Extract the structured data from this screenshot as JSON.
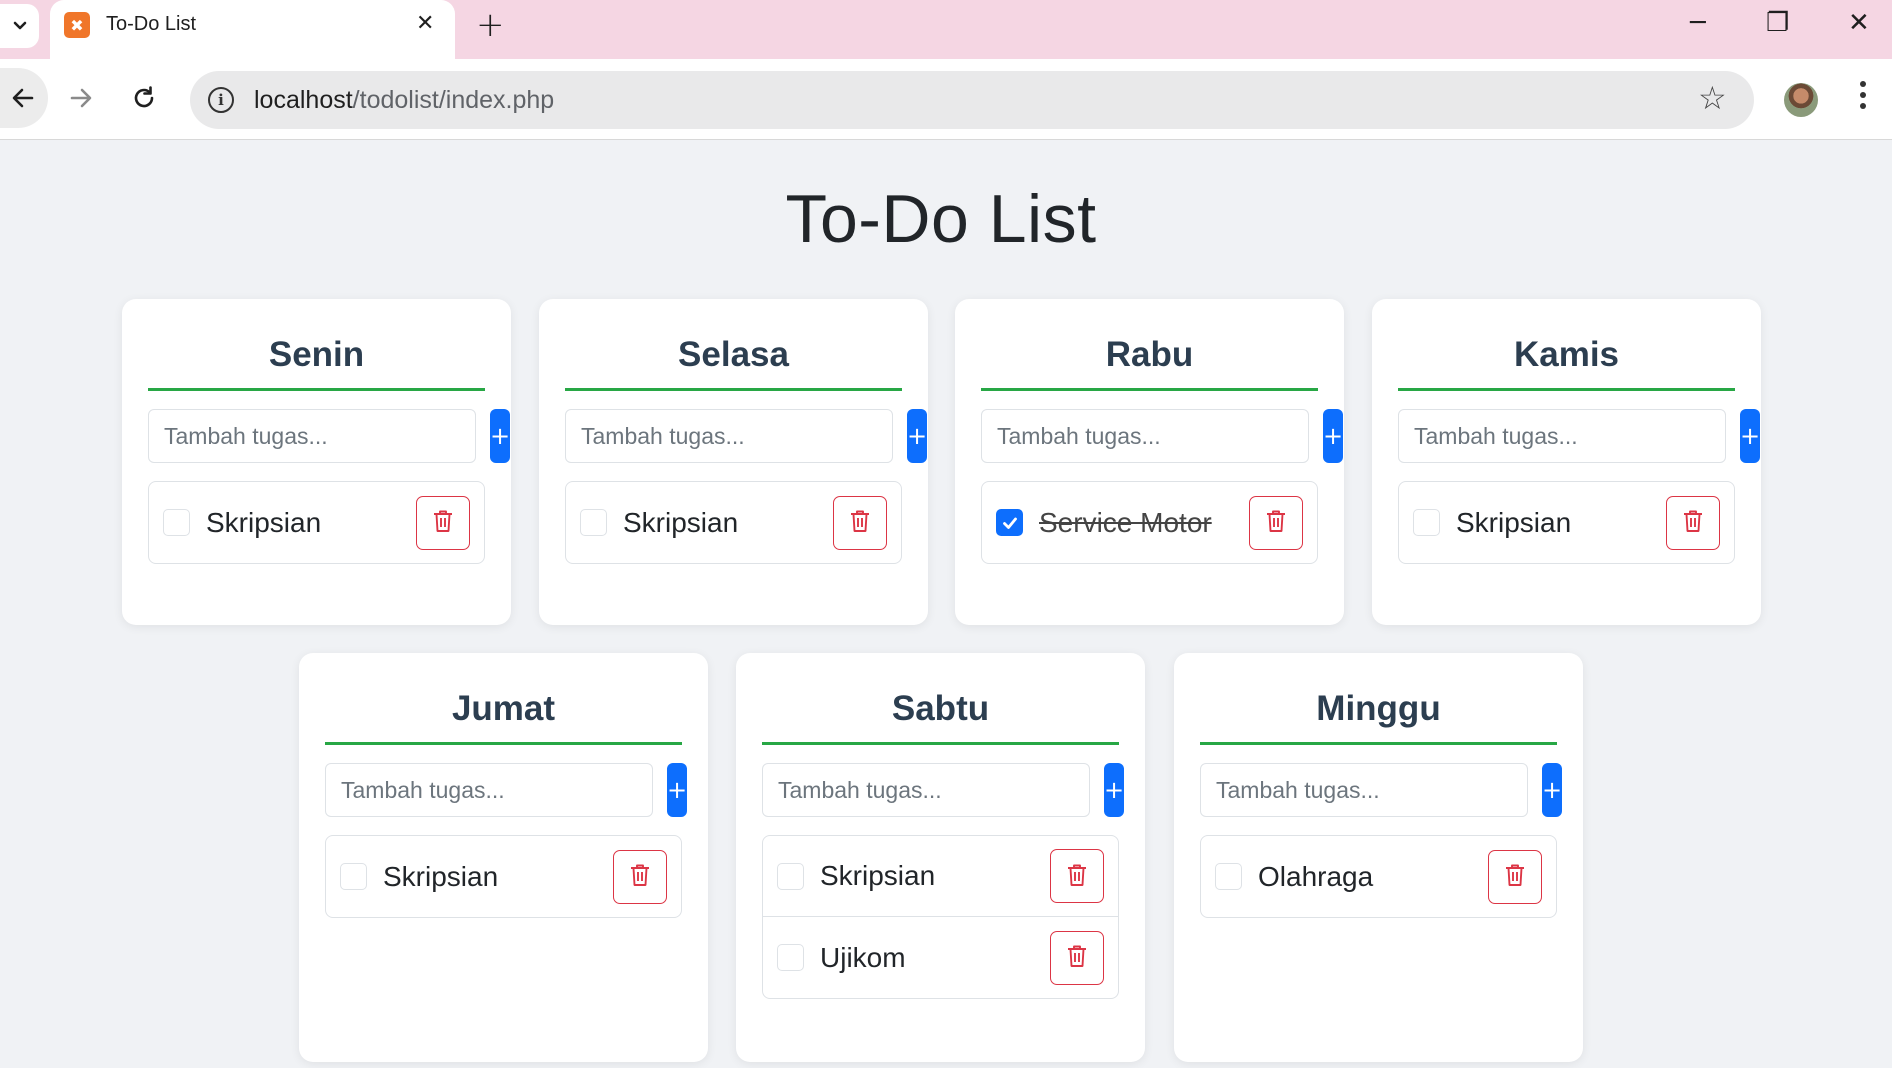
{
  "browser": {
    "tab_title": "To-Do List",
    "url_host": "localhost",
    "url_path": "/todolist/index.php"
  },
  "page": {
    "title": "To-Do List",
    "placeholder": "Tambah tugas...",
    "add_label": "+"
  },
  "days": [
    {
      "name": "Senin",
      "tasks": [
        {
          "text": "Skripsian",
          "done": false
        }
      ]
    },
    {
      "name": "Selasa",
      "tasks": [
        {
          "text": "Skripsian",
          "done": false
        }
      ]
    },
    {
      "name": "Rabu",
      "tasks": [
        {
          "text": "Service Motor",
          "done": true
        }
      ]
    },
    {
      "name": "Kamis",
      "tasks": [
        {
          "text": "Skripsian",
          "done": false
        }
      ]
    },
    {
      "name": "Jumat",
      "tasks": [
        {
          "text": "Skripsian",
          "done": false
        }
      ]
    },
    {
      "name": "Sabtu",
      "tasks": [
        {
          "text": "Skripsian",
          "done": false
        },
        {
          "text": "Ujikom",
          "done": false
        }
      ]
    },
    {
      "name": "Minggu",
      "tasks": [
        {
          "text": "Olahraga",
          "done": false
        }
      ]
    }
  ],
  "colors": {
    "accent_blue": "#0d6efd",
    "delete_red": "#dc3545",
    "divider_green": "#28a745",
    "heading": "#2c3e50",
    "tab_strip": "#f5d6e3"
  }
}
